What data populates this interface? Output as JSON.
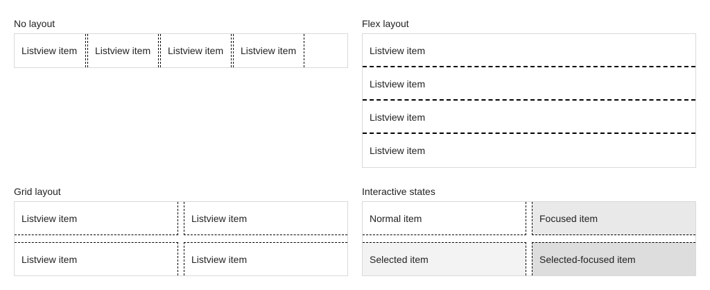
{
  "no_layout": {
    "title": "No layout",
    "items": [
      "Listview item",
      "Listview item",
      "Listview item",
      "Listview item"
    ]
  },
  "flex_layout": {
    "title": "Flex layout",
    "items": [
      "Listview item",
      "Listview item",
      "Listview item",
      "Listview item"
    ]
  },
  "grid_layout": {
    "title": "Grid layout",
    "items": [
      "Listview item",
      "Listview item",
      "Listview item",
      "Listview item"
    ]
  },
  "interactive_states": {
    "title": "Interactive states",
    "items": [
      "Normal item",
      "Focused item",
      "Selected item",
      "Selected-focused item"
    ]
  },
  "colors": {
    "border": "#d9d9d9",
    "separator": "#000000",
    "focused_bg": "#e9e9e9",
    "selected_bg": "#f3f3f3",
    "selected_focused_bg": "#dddddd"
  }
}
